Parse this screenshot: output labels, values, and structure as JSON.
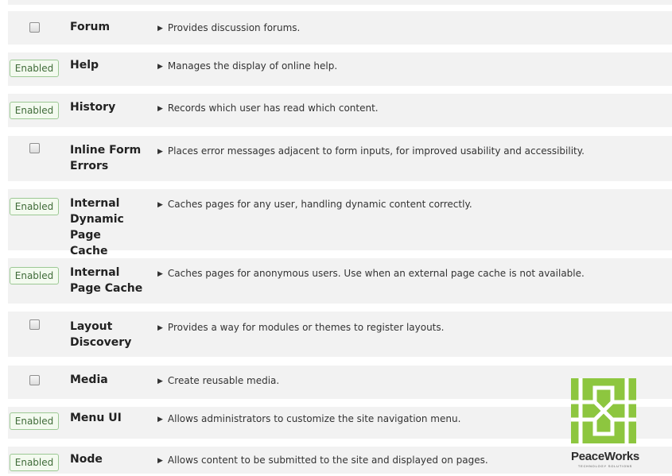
{
  "modules": [
    {
      "name": "Forum",
      "enabled": false,
      "status": "",
      "description": "Provides discussion forums."
    },
    {
      "name": "Help",
      "enabled": true,
      "status": "Enabled",
      "description": "Manages the display of online help."
    },
    {
      "name": "History",
      "enabled": true,
      "status": "Enabled",
      "description": "Records which user has read which content."
    },
    {
      "name": "Inline Form Errors",
      "enabled": false,
      "status": "",
      "description": "Places error messages adjacent to form inputs, for improved usability and accessibility."
    },
    {
      "name": "Internal Dynamic Page Cache",
      "enabled": true,
      "status": "Enabled",
      "description": "Caches pages for any user, handling dynamic content correctly."
    },
    {
      "name": "Internal Page Cache",
      "enabled": true,
      "status": "Enabled",
      "description": "Caches pages for anonymous users. Use when an external page cache is not available."
    },
    {
      "name": "Layout Discovery",
      "enabled": false,
      "status": "",
      "description": "Provides a way for modules or themes to register layouts."
    },
    {
      "name": "Media",
      "enabled": false,
      "status": "",
      "description": "Create reusable media."
    },
    {
      "name": "Menu UI",
      "enabled": true,
      "status": "Enabled",
      "description": "Allows administrators to customize the site navigation menu."
    },
    {
      "name": "Node",
      "enabled": true,
      "status": "Enabled",
      "description": "Allows content to be submitted to the site and displayed on pages."
    }
  ],
  "logo": {
    "name": "PeaceWorks",
    "tagline": "TECHNOLOGY SOLUTIONS",
    "color": "#8dc63f"
  }
}
